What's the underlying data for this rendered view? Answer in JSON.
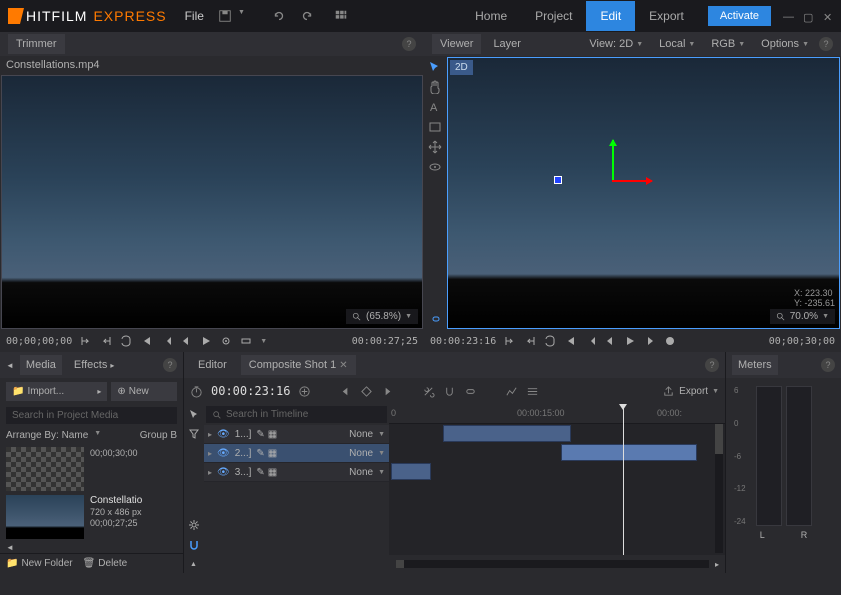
{
  "app": {
    "brand1": "HITFILM",
    "brand2": "EXPRESS"
  },
  "menu": {
    "file": "File"
  },
  "nav": {
    "home": "Home",
    "project": "Project",
    "edit": "Edit",
    "export": "Export"
  },
  "activate": "Activate",
  "trimmer": {
    "tab": "Trimmer",
    "clip": "Constellations.mp4",
    "zoom": "(65.8%)",
    "tc_start": "00;00;00;00",
    "tc_end": "00:00:27;25"
  },
  "viewer": {
    "tab_viewer": "Viewer",
    "tab_layer": "Layer",
    "view_mode": "View: 2D",
    "local": "Local",
    "rgb": "RGB",
    "options": "Options",
    "badge": "2D",
    "coord_x": "X:   223.30",
    "coord_y": "Y:  -235.61",
    "zoom": "70.0%",
    "tc_start": "00:00:23:16",
    "tc_end": "00;00;30;00"
  },
  "media": {
    "tab_media": "Media",
    "tab_effects": "Effects",
    "import": "Import...",
    "new": "New",
    "search_placeholder": "Search in Project Media",
    "arrange": "Arrange By: Name",
    "group": "Group B",
    "items": [
      {
        "name": "",
        "dur": "00;00;30;00"
      },
      {
        "name": "Constellatio",
        "res": "720 x 486 px",
        "dur": "00;00;27;25"
      }
    ],
    "new_folder": "New Folder",
    "delete": "Delete"
  },
  "editor": {
    "tab_editor": "Editor",
    "tab_comp": "Composite Shot 1",
    "tc": "00:00:23:16",
    "search_placeholder": "Search in Timeline",
    "tracks": [
      {
        "label": "1...]",
        "mode": "None"
      },
      {
        "label": "2...]",
        "mode": "None"
      },
      {
        "label": "3...]",
        "mode": "None"
      }
    ],
    "ruler": {
      "t0": "0",
      "t1": "00:00:15:00",
      "t2": "00:00:"
    },
    "export": "Export"
  },
  "meters": {
    "tab": "Meters",
    "scale": [
      "6",
      "0",
      "-6",
      "-12",
      "-24"
    ],
    "labels": [
      "L",
      "R"
    ]
  }
}
